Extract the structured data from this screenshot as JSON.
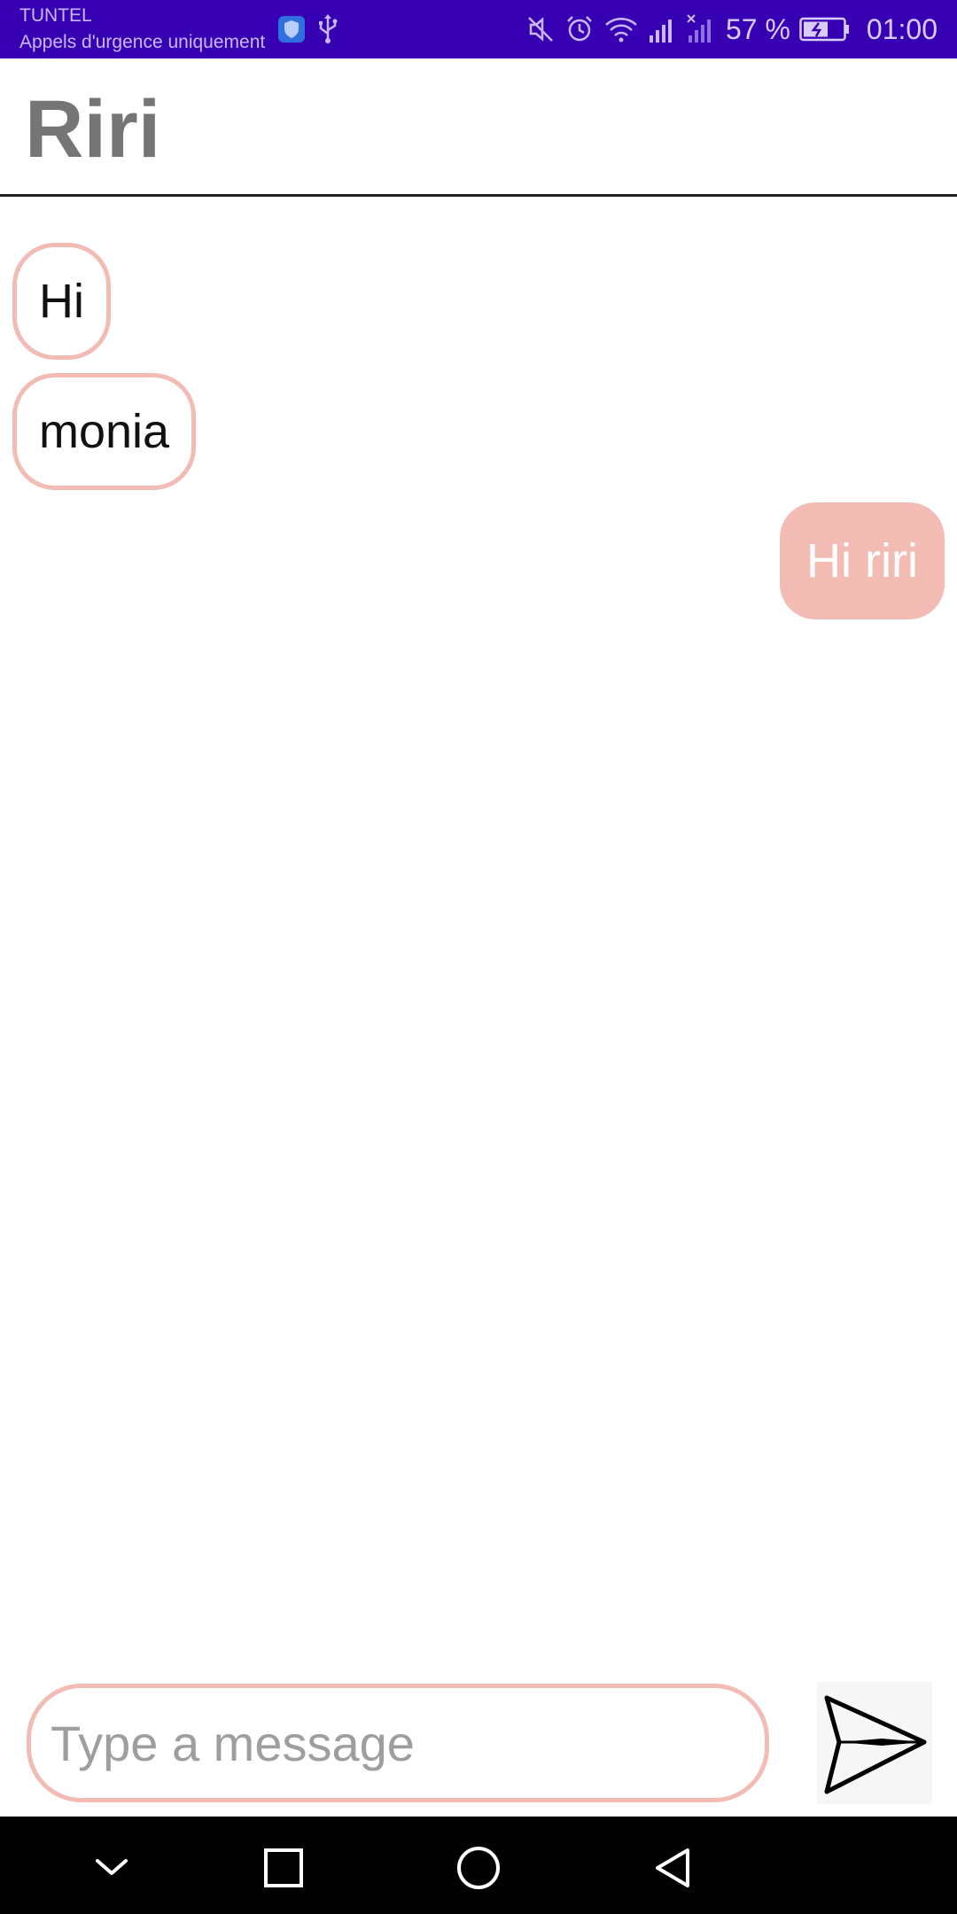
{
  "status_bar": {
    "carrier": "TUNTEL",
    "emergency_text": "Appels d'urgence uniquement",
    "battery": "57 %",
    "time": "01:00",
    "icons": [
      "shield-icon",
      "usb-icon",
      "mute-icon",
      "alarm-icon",
      "wifi-icon",
      "signal-icon",
      "signal-no-sim-icon",
      "battery-charging-icon"
    ],
    "background_color": "#3700b3"
  },
  "app_bar": {
    "title": "Riri"
  },
  "messages": [
    {
      "text": "Hi",
      "direction": "received"
    },
    {
      "text": "monia",
      "direction": "received"
    },
    {
      "text": "Hi riri",
      "direction": "sent"
    }
  ],
  "composer": {
    "placeholder": "Type a message",
    "value": "",
    "send_icon": "send-icon"
  },
  "nav_bar": {
    "icons": [
      "chevron-down-icon",
      "recents-icon",
      "home-icon",
      "back-icon"
    ]
  },
  "colors": {
    "accent_pink": "#f2bcb5",
    "title_gray": "#757575"
  }
}
